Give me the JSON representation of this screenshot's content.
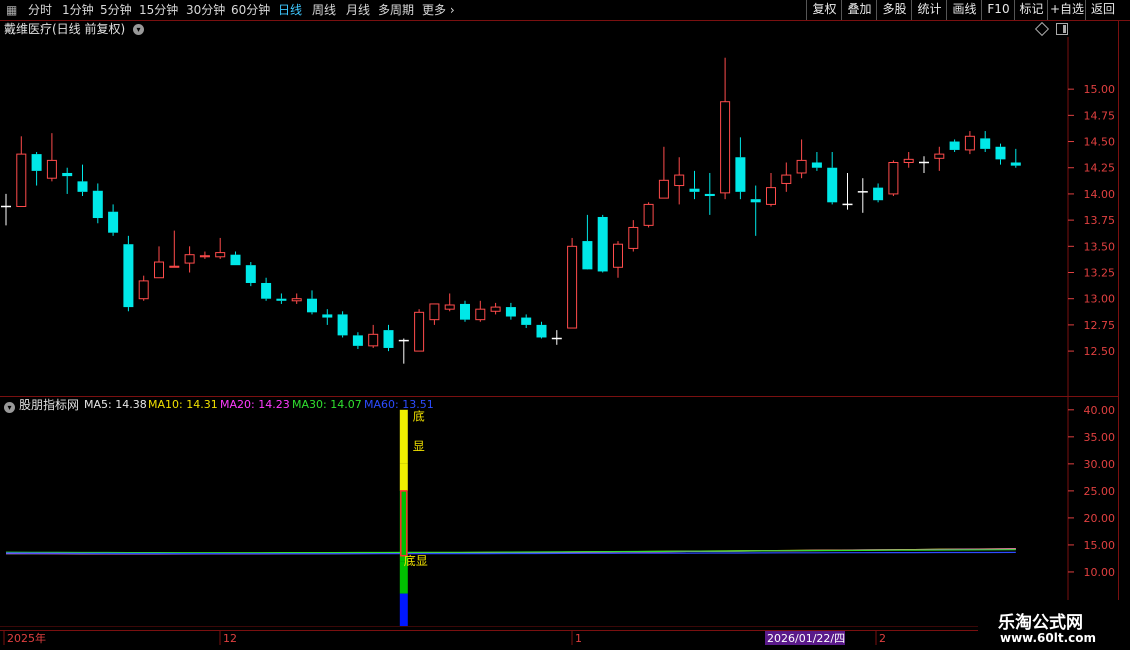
{
  "toolbar": {
    "periods": [
      "分时",
      "1分钟",
      "5分钟",
      "15分钟",
      "30分钟",
      "60分钟",
      "日线",
      "周线",
      "月线",
      "多周期",
      "更多"
    ],
    "active_period": "日线",
    "right_buttons": [
      "复权",
      "叠加",
      "多股",
      "统计",
      "画线",
      "F10",
      "标记",
      "+自选",
      "返回"
    ]
  },
  "stock": {
    "title": "戴维医疗(日线 前复权)"
  },
  "indicator": {
    "name": "股朋指标网",
    "ma_labels": [
      {
        "text": "MA5: 14.38",
        "color": "#e8e8e8"
      },
      {
        "text": "MA10: 14.31",
        "color": "#f0e000"
      },
      {
        "text": "MA20: 14.23",
        "color": "#ff3cff"
      },
      {
        "text": "MA30: 14.07",
        "color": "#30e030"
      },
      {
        "text": "MA60: 13.51",
        "color": "#2c4cff"
      }
    ],
    "signal_text_top": [
      "底",
      "显"
    ],
    "signal_text_bottom": "底显"
  },
  "time_axis": {
    "labels": [
      "2025年",
      "12",
      "1",
      "2"
    ],
    "cursor_date": "2026/01/22/四"
  },
  "brand": {
    "name": "乐淘公式网",
    "url": "www.60lt.com"
  },
  "colors": {
    "up": "#ff4c4c",
    "down": "#00e8e8",
    "neutral": "#ffffff",
    "grid": "#7a1010",
    "axis": "#e04040"
  },
  "chart_data": [
    {
      "type": "candlestick",
      "title": "戴维医疗(日线 前复权)",
      "ylim": [
        12.1,
        15.45
      ],
      "y_ticks": [
        12.5,
        12.75,
        13.0,
        13.25,
        13.5,
        13.75,
        14.0,
        14.25,
        14.5,
        14.75,
        15.0
      ],
      "candles": [
        {
          "o": 13.88,
          "h": 14.0,
          "l": 13.7,
          "c": 13.88
        },
        {
          "o": 13.88,
          "h": 14.55,
          "l": 13.88,
          "c": 14.38
        },
        {
          "o": 14.38,
          "h": 14.4,
          "l": 14.08,
          "c": 14.22
        },
        {
          "o": 14.15,
          "h": 14.58,
          "l": 14.12,
          "c": 14.32
        },
        {
          "o": 14.2,
          "h": 14.25,
          "l": 14.0,
          "c": 14.17
        },
        {
          "o": 14.12,
          "h": 14.28,
          "l": 13.98,
          "c": 14.02
        },
        {
          "o": 14.03,
          "h": 14.1,
          "l": 13.72,
          "c": 13.77
        },
        {
          "o": 13.83,
          "h": 13.9,
          "l": 13.6,
          "c": 13.63
        },
        {
          "o": 13.52,
          "h": 13.6,
          "l": 12.88,
          "c": 12.92
        },
        {
          "o": 13.0,
          "h": 13.22,
          "l": 12.98,
          "c": 13.17
        },
        {
          "o": 13.2,
          "h": 13.5,
          "l": 13.2,
          "c": 13.35
        },
        {
          "o": 13.3,
          "h": 13.65,
          "l": 13.3,
          "c": 13.31
        },
        {
          "o": 13.34,
          "h": 13.5,
          "l": 13.25,
          "c": 13.42
        },
        {
          "o": 13.4,
          "h": 13.45,
          "l": 13.38,
          "c": 13.41
        },
        {
          "o": 13.4,
          "h": 13.58,
          "l": 13.38,
          "c": 13.44
        },
        {
          "o": 13.42,
          "h": 13.45,
          "l": 13.32,
          "c": 13.32
        },
        {
          "o": 13.32,
          "h": 13.35,
          "l": 13.12,
          "c": 13.15
        },
        {
          "o": 13.15,
          "h": 13.2,
          "l": 12.98,
          "c": 13.0
        },
        {
          "o": 13.0,
          "h": 13.05,
          "l": 12.95,
          "c": 12.98
        },
        {
          "o": 12.98,
          "h": 13.05,
          "l": 12.95,
          "c": 13.0
        },
        {
          "o": 13.0,
          "h": 13.08,
          "l": 12.85,
          "c": 12.87
        },
        {
          "o": 12.85,
          "h": 12.9,
          "l": 12.75,
          "c": 12.82
        },
        {
          "o": 12.85,
          "h": 12.88,
          "l": 12.63,
          "c": 12.65
        },
        {
          "o": 12.65,
          "h": 12.68,
          "l": 12.52,
          "c": 12.55
        },
        {
          "o": 12.55,
          "h": 12.75,
          "l": 12.53,
          "c": 12.66
        },
        {
          "o": 12.7,
          "h": 12.75,
          "l": 12.5,
          "c": 12.53
        },
        {
          "o": 12.6,
          "h": 12.62,
          "l": 12.38,
          "c": 12.6
        },
        {
          "o": 12.5,
          "h": 12.9,
          "l": 12.5,
          "c": 12.87
        },
        {
          "o": 12.8,
          "h": 12.95,
          "l": 12.75,
          "c": 12.95
        },
        {
          "o": 12.9,
          "h": 13.05,
          "l": 12.88,
          "c": 12.94
        },
        {
          "o": 12.95,
          "h": 12.98,
          "l": 12.78,
          "c": 12.8
        },
        {
          "o": 12.8,
          "h": 12.98,
          "l": 12.78,
          "c": 12.9
        },
        {
          "o": 12.88,
          "h": 12.96,
          "l": 12.85,
          "c": 12.92
        },
        {
          "o": 12.92,
          "h": 12.96,
          "l": 12.8,
          "c": 12.83
        },
        {
          "o": 12.82,
          "h": 12.85,
          "l": 12.72,
          "c": 12.75
        },
        {
          "o": 12.75,
          "h": 12.78,
          "l": 12.62,
          "c": 12.63
        },
        {
          "o": 12.62,
          "h": 12.7,
          "l": 12.56,
          "c": 12.62
        },
        {
          "o": 12.72,
          "h": 13.58,
          "l": 12.72,
          "c": 13.5
        },
        {
          "o": 13.55,
          "h": 13.8,
          "l": 13.4,
          "c": 13.28
        },
        {
          "o": 13.78,
          "h": 13.8,
          "l": 13.25,
          "c": 13.26
        },
        {
          "o": 13.3,
          "h": 13.55,
          "l": 13.2,
          "c": 13.52
        },
        {
          "o": 13.48,
          "h": 13.75,
          "l": 13.45,
          "c": 13.68
        },
        {
          "o": 13.7,
          "h": 13.92,
          "l": 13.68,
          "c": 13.9
        },
        {
          "o": 13.96,
          "h": 14.45,
          "l": 13.96,
          "c": 14.13
        },
        {
          "o": 14.08,
          "h": 14.35,
          "l": 13.9,
          "c": 14.18
        },
        {
          "o": 14.05,
          "h": 14.22,
          "l": 13.95,
          "c": 14.02
        },
        {
          "o": 14.0,
          "h": 14.2,
          "l": 13.8,
          "c": 13.98
        },
        {
          "o": 14.01,
          "h": 15.3,
          "l": 13.95,
          "c": 14.88
        },
        {
          "o": 14.35,
          "h": 14.54,
          "l": 13.95,
          "c": 14.02
        },
        {
          "o": 13.95,
          "h": 14.08,
          "l": 13.6,
          "c": 13.92
        },
        {
          "o": 13.9,
          "h": 14.2,
          "l": 13.88,
          "c": 14.06
        },
        {
          "o": 14.1,
          "h": 14.3,
          "l": 14.02,
          "c": 14.18
        },
        {
          "o": 14.2,
          "h": 14.52,
          "l": 14.15,
          "c": 14.32
        },
        {
          "o": 14.3,
          "h": 14.4,
          "l": 14.22,
          "c": 14.25
        },
        {
          "o": 14.25,
          "h": 14.4,
          "l": 13.9,
          "c": 13.92
        },
        {
          "o": 13.9,
          "h": 14.2,
          "l": 13.85,
          "c": 13.9
        },
        {
          "o": 14.02,
          "h": 14.15,
          "l": 13.82,
          "c": 14.02
        },
        {
          "o": 14.06,
          "h": 14.1,
          "l": 13.92,
          "c": 13.94
        },
        {
          "o": 14.0,
          "h": 14.32,
          "l": 13.98,
          "c": 14.3
        },
        {
          "o": 14.3,
          "h": 14.4,
          "l": 14.25,
          "c": 14.33
        },
        {
          "o": 14.3,
          "h": 14.36,
          "l": 14.2,
          "c": 14.3
        },
        {
          "o": 14.34,
          "h": 14.45,
          "l": 14.22,
          "c": 14.38
        },
        {
          "o": 14.5,
          "h": 14.52,
          "l": 14.4,
          "c": 14.42
        },
        {
          "o": 14.42,
          "h": 14.6,
          "l": 14.38,
          "c": 14.55
        },
        {
          "o": 14.53,
          "h": 14.6,
          "l": 14.4,
          "c": 14.43
        },
        {
          "o": 14.45,
          "h": 14.48,
          "l": 14.28,
          "c": 14.33
        },
        {
          "o": 14.3,
          "h": 14.43,
          "l": 14.25,
          "c": 14.27
        }
      ]
    },
    {
      "type": "line",
      "title": "股朋指标网",
      "ylim": [
        0.0,
        42.0
      ],
      "y_ticks": [
        10.0,
        15.0,
        20.0,
        25.0,
        30.0,
        35.0,
        40.0
      ],
      "series": [
        {
          "name": "MA5",
          "start": 13.5,
          "end": 14.38
        },
        {
          "name": "MA10",
          "start": 13.55,
          "end": 14.31
        },
        {
          "name": "MA20",
          "start": 13.45,
          "end": 14.23
        },
        {
          "name": "MA30",
          "start": 13.6,
          "end": 14.07
        },
        {
          "name": "MA60",
          "start": 13.4,
          "end": 13.51
        }
      ],
      "signal_bar": {
        "x_index": 26,
        "segments": [
          {
            "from": 30.0,
            "to": 40.0,
            "color": "#f0f000"
          },
          {
            "from": 25.0,
            "to": 30.0,
            "color": "#f0f000"
          },
          {
            "from": 12.0,
            "to": 25.0,
            "color": "#00c000"
          },
          {
            "from": 6.0,
            "to": 12.0,
            "color": "#00c000"
          },
          {
            "from": 0.0,
            "to": 6.0,
            "color": "#0018ff"
          }
        ]
      }
    }
  ]
}
